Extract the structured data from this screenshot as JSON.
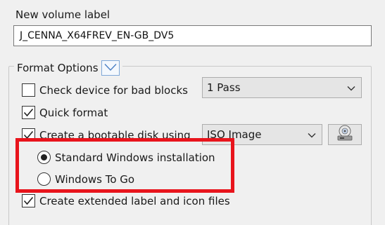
{
  "volume": {
    "label": "New volume label",
    "value": "J_CENNA_X64FREV_EN-GB_DV5"
  },
  "format_options": {
    "title": "Format Options",
    "check_bad_blocks": {
      "label": "Check device for bad blocks",
      "checked": false
    },
    "passes": {
      "value": "1 Pass"
    },
    "quick_format": {
      "label": "Quick format",
      "checked": true
    },
    "bootable": {
      "label": "Create a bootable disk using",
      "checked": true
    },
    "boot_type": {
      "value": "ISO Image"
    },
    "install_mode": {
      "options": [
        {
          "label": "Standard Windows installation",
          "selected": true
        },
        {
          "label": "Windows To Go",
          "selected": false
        }
      ]
    },
    "extended_label": {
      "label": "Create extended label and icon files",
      "checked": true
    }
  },
  "colors": {
    "highlight": "#e8141c",
    "accent": "#7fa8d8"
  },
  "icons": {
    "toggle": "chevron-down-icon",
    "disc": "disc-drive-icon"
  }
}
